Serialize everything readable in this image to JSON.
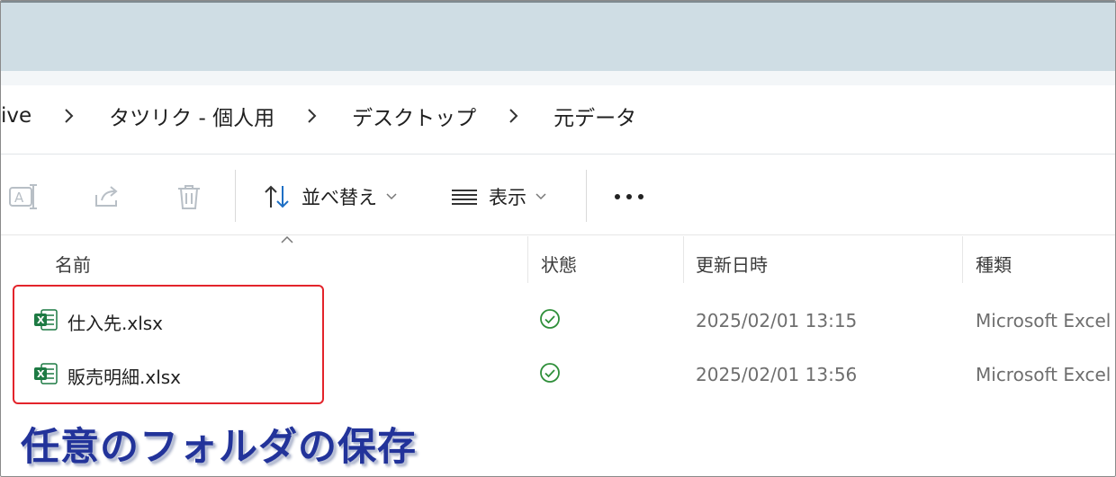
{
  "breadcrumb": {
    "items": [
      "ive",
      "タツリク - 個人用",
      "デスクトップ",
      "元データ"
    ]
  },
  "toolbar": {
    "sort_label": "並べ替え",
    "view_label": "表示"
  },
  "columns": {
    "name": "名前",
    "status": "状態",
    "modified": "更新日時",
    "type": "種類"
  },
  "files": [
    {
      "name": "仕入先.xlsx",
      "status_icon": "synced-check-icon",
      "modified": "2025/02/01 13:15",
      "type": "Microsoft Excel"
    },
    {
      "name": "販売明細.xlsx",
      "status_icon": "synced-check-icon",
      "modified": "2025/02/01 13:56",
      "type": "Microsoft Excel"
    }
  ],
  "caption": "任意のフォルダの保存",
  "colors": {
    "title_bar": "#cfdde4",
    "highlight_border": "#e3242b",
    "caption_text": "#22339a",
    "excel_green": "#1d7a43",
    "sync_green": "#2f8f3a",
    "sort_blue": "#1e6fc4"
  }
}
